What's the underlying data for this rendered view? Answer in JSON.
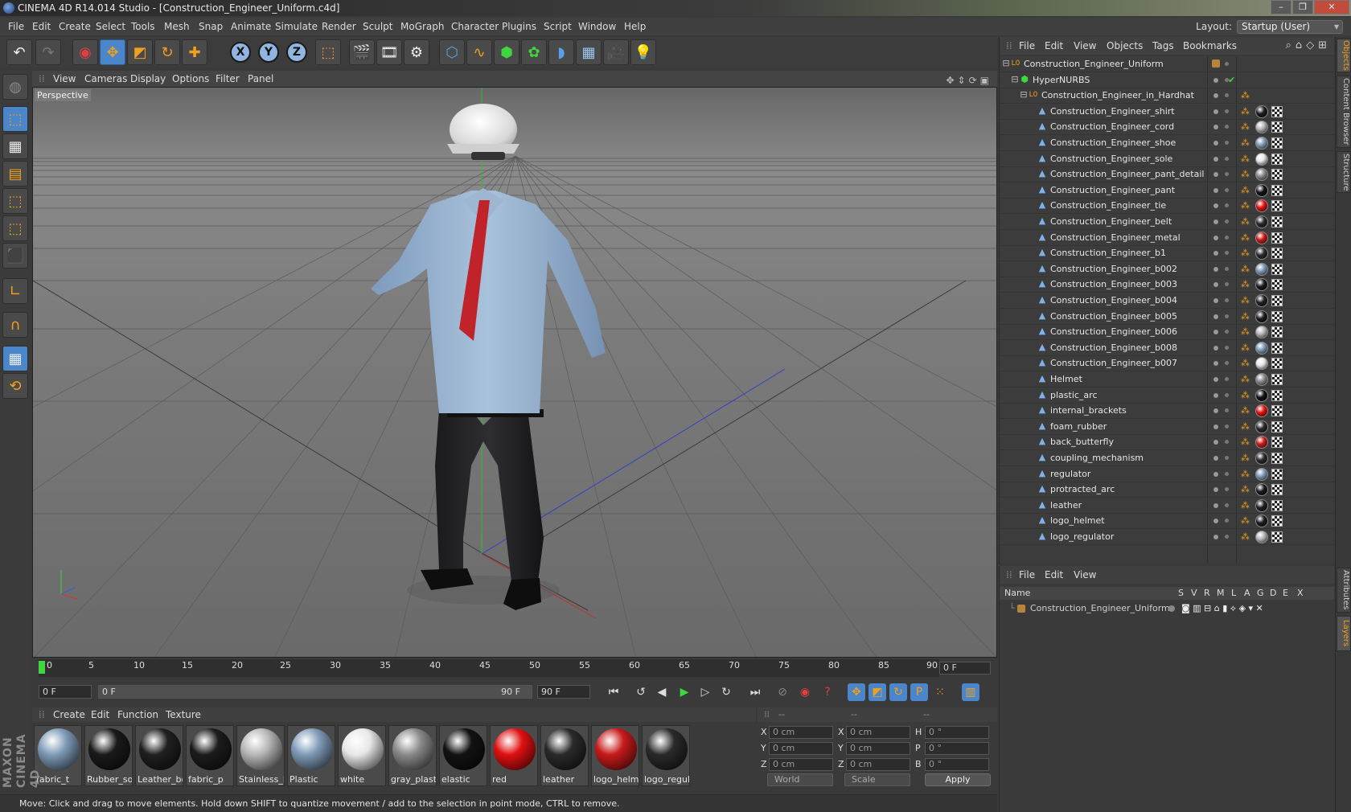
{
  "window": {
    "title": "CINEMA 4D R14.014 Studio - [Construction_Engineer_Uniform.c4d]"
  },
  "menubar": [
    "File",
    "Edit",
    "Create",
    "Select",
    "Tools",
    "Mesh",
    "Snap",
    "Animate",
    "Simulate",
    "Render",
    "Sculpt",
    "MoGraph",
    "Character",
    "Plugins",
    "Script",
    "Window",
    "Help"
  ],
  "layout": {
    "label": "Layout:",
    "value": "Startup (User)"
  },
  "viewport": {
    "menu": [
      "View",
      "Cameras",
      "Display",
      "Options",
      "Filter",
      "Panel"
    ],
    "label": "Perspective"
  },
  "timeline": {
    "ticks": [
      "0",
      "5",
      "10",
      "15",
      "20",
      "25",
      "30",
      "35",
      "40",
      "45",
      "50",
      "55",
      "60",
      "65",
      "70",
      "75",
      "80",
      "85",
      "90"
    ],
    "current": "0 F"
  },
  "playback": {
    "start": "0 F",
    "range_start": "0 F",
    "range_end": "90 F",
    "end": "90 F"
  },
  "materials": {
    "menu": [
      "Create",
      "Edit",
      "Function",
      "Texture"
    ],
    "items": [
      {
        "name": "fabric_t",
        "color": "#7f9bb8"
      },
      {
        "name": "Rubber_so",
        "color": "#1a1a1a"
      },
      {
        "name": "Leather_bo",
        "color": "#202020"
      },
      {
        "name": "fabric_p",
        "color": "#1c1c1c"
      },
      {
        "name": "Stainless_h",
        "color": "#b8b8b8"
      },
      {
        "name": "Plastic",
        "color": "#7f9bb8"
      },
      {
        "name": "white",
        "color": "#e8e8e8"
      },
      {
        "name": "gray_plasti",
        "color": "#8a8a8a"
      },
      {
        "name": "elastic",
        "color": "#121212"
      },
      {
        "name": "red",
        "color": "#e01010"
      },
      {
        "name": "leather",
        "color": "#2a2a2a"
      },
      {
        "name": "logo_helm",
        "color": "#c81a1a"
      },
      {
        "name": "logo_regul",
        "color": "#2a2a2a"
      }
    ]
  },
  "coords": {
    "headers": [
      "--",
      "--",
      "--"
    ],
    "rows": [
      {
        "a": "X",
        "av": "0 cm",
        "b": "X",
        "bv": "0 cm",
        "c": "H",
        "cv": "0 °"
      },
      {
        "a": "Y",
        "av": "0 cm",
        "b": "Y",
        "bv": "0 cm",
        "c": "P",
        "cv": "0 °"
      },
      {
        "a": "Z",
        "av": "0 cm",
        "b": "Z",
        "bv": "0 cm",
        "c": "B",
        "cv": "0 °"
      }
    ],
    "mode1": "World",
    "mode2": "Scale",
    "apply": "Apply"
  },
  "status": "Move: Click and drag to move elements. Hold down SHIFT to quantize movement / add to the selection in point mode, CTRL to remove.",
  "maxon": "MAXON CINEMA 4D",
  "objects": {
    "menu": [
      "File",
      "Edit",
      "View",
      "Objects",
      "Tags",
      "Bookmarks"
    ],
    "items": [
      {
        "name": "Construction_Engineer_Uniform",
        "level": 0,
        "type": "null"
      },
      {
        "name": "HyperNURBS",
        "level": 1,
        "type": "nurbs"
      },
      {
        "name": "Construction_Engineer_in_Hardhat",
        "level": 2,
        "type": "null"
      },
      {
        "name": "Construction_Engineer_shirt",
        "level": 3,
        "type": "mesh"
      },
      {
        "name": "Construction_Engineer_cord",
        "level": 3,
        "type": "mesh"
      },
      {
        "name": "Construction_Engineer_shoe",
        "level": 3,
        "type": "mesh"
      },
      {
        "name": "Construction_Engineer_sole",
        "level": 3,
        "type": "mesh"
      },
      {
        "name": "Construction_Engineer_pant_detail",
        "level": 3,
        "type": "mesh"
      },
      {
        "name": "Construction_Engineer_pant",
        "level": 3,
        "type": "mesh"
      },
      {
        "name": "Construction_Engineer_tie",
        "level": 3,
        "type": "mesh"
      },
      {
        "name": "Construction_Engineer_belt",
        "level": 3,
        "type": "mesh"
      },
      {
        "name": "Construction_Engineer_metal",
        "level": 3,
        "type": "mesh"
      },
      {
        "name": "Construction_Engineer_b1",
        "level": 3,
        "type": "mesh"
      },
      {
        "name": "Construction_Engineer_b002",
        "level": 3,
        "type": "mesh"
      },
      {
        "name": "Construction_Engineer_b003",
        "level": 3,
        "type": "mesh"
      },
      {
        "name": "Construction_Engineer_b004",
        "level": 3,
        "type": "mesh"
      },
      {
        "name": "Construction_Engineer_b005",
        "level": 3,
        "type": "mesh"
      },
      {
        "name": "Construction_Engineer_b006",
        "level": 3,
        "type": "mesh"
      },
      {
        "name": "Construction_Engineer_b008",
        "level": 3,
        "type": "mesh"
      },
      {
        "name": "Construction_Engineer_b007",
        "level": 3,
        "type": "mesh"
      },
      {
        "name": "Helmet",
        "level": 3,
        "type": "mesh"
      },
      {
        "name": "plastic_arc",
        "level": 3,
        "type": "mesh"
      },
      {
        "name": "internal_brackets",
        "level": 3,
        "type": "mesh"
      },
      {
        "name": "foam_rubber",
        "level": 3,
        "type": "mesh"
      },
      {
        "name": "back_butterfly",
        "level": 3,
        "type": "mesh"
      },
      {
        "name": "coupling_mechanism",
        "level": 3,
        "type": "mesh"
      },
      {
        "name": "regulator",
        "level": 3,
        "type": "mesh"
      },
      {
        "name": "protracted_arc",
        "level": 3,
        "type": "mesh"
      },
      {
        "name": "leather",
        "level": 3,
        "type": "mesh"
      },
      {
        "name": "logo_helmet",
        "level": 3,
        "type": "mesh"
      },
      {
        "name": "logo_regulator",
        "level": 3,
        "type": "mesh"
      }
    ]
  },
  "layers": {
    "menu": [
      "File",
      "Edit",
      "View"
    ],
    "headers": [
      "Name",
      "S",
      "V",
      "R",
      "M",
      "L",
      "A",
      "G",
      "D",
      "E",
      "X"
    ],
    "row": "Construction_Engineer_Uniform"
  },
  "sidetabs": [
    "Objects",
    "Content Browser",
    "Structure",
    "Attributes",
    "Layers"
  ],
  "colors": {
    "accent": "#f0a020",
    "selected": "#4a86c9",
    "play": "#3fd63f"
  }
}
